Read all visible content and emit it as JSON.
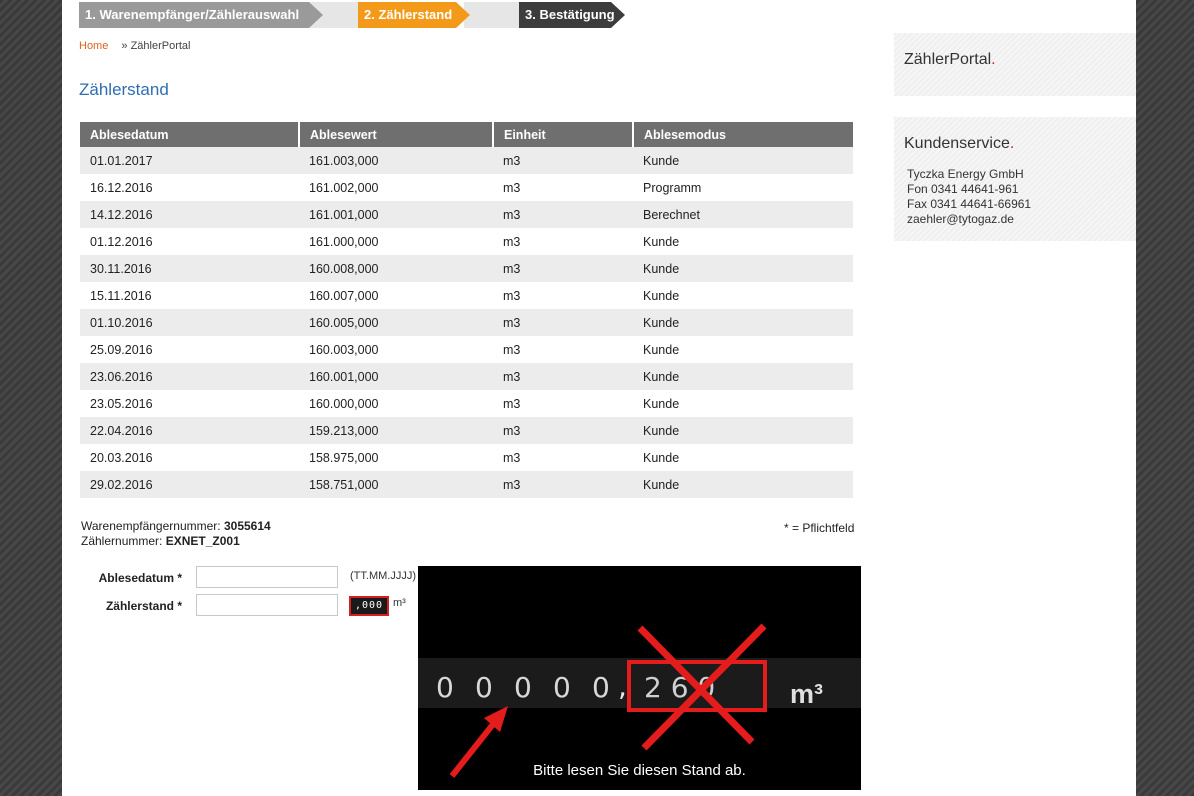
{
  "steps": [
    {
      "label": "1. Warenempfänger/Zählerauswahl"
    },
    {
      "label": "2. Zählerstand"
    },
    {
      "label": "3. Bestätigung"
    }
  ],
  "breadcrumb": {
    "home": "Home",
    "current": "» ZählerPortal"
  },
  "page_title": "Zählerstand",
  "table": {
    "headers": [
      "Ablesedatum",
      "Ablesewert",
      "Einheit",
      "Ablesemodus"
    ],
    "rows": [
      [
        "01.01.2017",
        "161.003,000",
        "m3",
        "Kunde"
      ],
      [
        "16.12.2016",
        "161.002,000",
        "m3",
        "Programm"
      ],
      [
        "14.12.2016",
        "161.001,000",
        "m3",
        "Berechnet"
      ],
      [
        "01.12.2016",
        "161.000,000",
        "m3",
        "Kunde"
      ],
      [
        "30.11.2016",
        "160.008,000",
        "m3",
        "Kunde"
      ],
      [
        "15.11.2016",
        "160.007,000",
        "m3",
        "Kunde"
      ],
      [
        "01.10.2016",
        "160.005,000",
        "m3",
        "Kunde"
      ],
      [
        "25.09.2016",
        "160.003,000",
        "m3",
        "Kunde"
      ],
      [
        "23.06.2016",
        "160.001,000",
        "m3",
        "Kunde"
      ],
      [
        "23.05.2016",
        "160.000,000",
        "m3",
        "Kunde"
      ],
      [
        "22.04.2016",
        "159.213,000",
        "m3",
        "Kunde"
      ],
      [
        "20.03.2016",
        "158.975,000",
        "m3",
        "Kunde"
      ],
      [
        "29.02.2016",
        "158.751,000",
        "m3",
        "Kunde"
      ]
    ]
  },
  "meta": {
    "recipient_label": "Warenempfängernummer:",
    "recipient_value": "3055614",
    "meter_label": "Zählernummer:",
    "meter_value": "EXNET_Z001",
    "required_note": "* = Pflichtfeld"
  },
  "form": {
    "date_label": "Ablesedatum *",
    "date_value": "",
    "date_hint": "(TT.MM.JJJJ)",
    "count_label": "Zählerstand *",
    "count_value": "",
    "decimal_display": ",000",
    "unit": "m³"
  },
  "meter_image": {
    "caption": "Bitte lesen Sie diesen Stand ab.",
    "digits": [
      "0",
      "0",
      "0",
      "0",
      "0"
    ],
    "decimals": "2 6 0",
    "unit": "m³",
    "accent": "#e51c1c"
  },
  "sidebar": {
    "portal_title": "ZählerPortal",
    "service_title": "Kundenservice",
    "service_lines": [
      "Tyczka Energy GmbH",
      "Fon 0341 44641-961",
      "Fax 0341 44641-66961",
      "zaehler@tytogaz.de"
    ]
  },
  "colors": {
    "accent_orange": "#f39a1b",
    "link_blue": "#2e6db4",
    "red": "#d42020"
  }
}
